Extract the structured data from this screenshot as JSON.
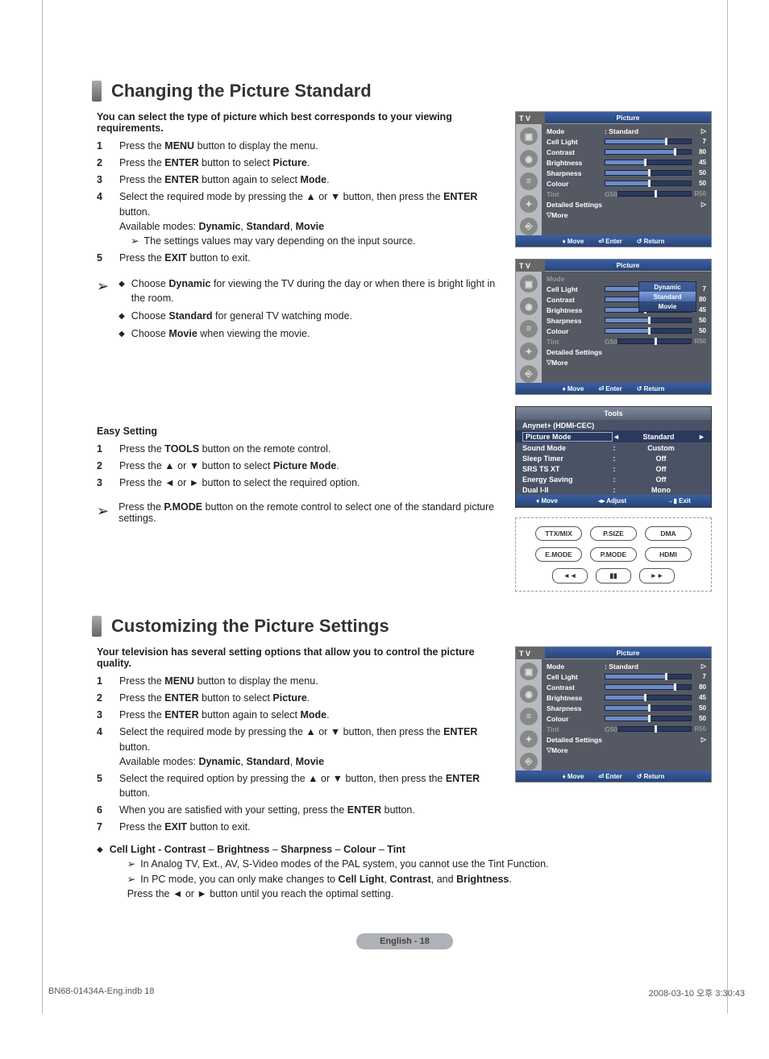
{
  "section1": {
    "title": "Changing the Picture Standard",
    "intro": "You can select the type of picture which best corresponds to your viewing requirements.",
    "step1_pre": "Press the ",
    "step1_b": "MENU",
    "step1_post": " button to display the menu.",
    "step2_pre": "Press the ",
    "step2_b": "ENTER",
    "step2_mid": " button to select ",
    "step2_b2": "Picture",
    "step2_post": ".",
    "step3_pre": "Press the ",
    "step3_b": "ENTER",
    "step3_mid": " button again to select ",
    "step3_b2": "Mode",
    "step3_post": ".",
    "step4_pre": "Select the required mode by pressing the ▲ or ▼ button, then press the ",
    "step4_b": "ENTER",
    "step4_post": " button.",
    "step4_avail_pre": "Available modes: ",
    "step4_avail_b1": "Dynamic",
    "step4_avail_s1": ", ",
    "step4_avail_b2": "Standard",
    "step4_avail_s2": ", ",
    "step4_avail_b3": "Movie",
    "step4_note": "The settings values may vary depending on the input source.",
    "step5_pre": "Press the ",
    "step5_b": "EXIT",
    "step5_post": " button to exit.",
    "tip1_pre": "Choose ",
    "tip1_b": "Dynamic",
    "tip1_post": " for viewing the TV during the day or when there is bright light in the room.",
    "tip2_pre": "Choose ",
    "tip2_b": "Standard",
    "tip2_post": " for general TV watching mode.",
    "tip3_pre": "Choose ",
    "tip3_b": "Movie",
    "tip3_post": " when viewing the movie.",
    "easy_title": "Easy Setting",
    "easy1_pre": "Press the ",
    "easy1_b": "TOOLS",
    "easy1_post": " button on the remote control.",
    "easy2_pre": "Press the ▲ or ▼ button to select ",
    "easy2_b": "Picture Mode",
    "easy2_post": ".",
    "easy3": "Press the ◄ or ► button to select the required option.",
    "pmode_pre": "Press the ",
    "pmode_b": "P.MODE",
    "pmode_post": " button on the remote control to select one of the standard picture settings."
  },
  "section2": {
    "title": "Customizing the Picture Settings",
    "intro": "Your television has several setting options that allow you to control the picture quality.",
    "step1_pre": "Press the ",
    "step1_b": "MENU",
    "step1_post": " button to display the menu.",
    "step2_pre": "Press the ",
    "step2_b": "ENTER",
    "step2_mid": " button to select ",
    "step2_b2": "Picture",
    "step2_post": ".",
    "step3_pre": "Press the ",
    "step3_b": "ENTER",
    "step3_mid": " button again to select ",
    "step3_b2": "Mode",
    "step3_post": ".",
    "step4_pre": "Select the required mode by pressing the ▲ or ▼ button, then press the ",
    "step4_b": "ENTER",
    "step4_post": " button.",
    "step4_avail_pre": "Available modes: ",
    "step4_avail_b1": "Dynamic",
    "step4_avail_s1": ", ",
    "step4_avail_b2": "Standard",
    "step4_avail_s2": ", ",
    "step4_avail_b3": "Movie",
    "step5_pre": "Select the required option by pressing the ▲ or ▼ button, then press the ",
    "step5_b": "ENTER",
    "step5_post": " button.",
    "step6_pre": "When you are satisfied with your setting, press the ",
    "step6_b": "ENTER",
    "step6_post": " button.",
    "step7_pre": "Press the ",
    "step7_b": "EXIT",
    "step7_post": " button to exit.",
    "param_b1": "Cell Light - Contrast",
    "param_s1": " – ",
    "param_b2": "Brightness",
    "param_s2": " – ",
    "param_b3": "Sharpness",
    "param_s3": " – ",
    "param_b4": "Colour",
    "param_s4": " – ",
    "param_b5": "Tint",
    "note1": "In Analog TV, Ext., AV, S-Video modes of the PAL system, you cannot use the Tint Function.",
    "note2_pre": "In PC mode, you can only make changes to ",
    "note2_b1": "Cell Light",
    "note2_s1": ", ",
    "note2_b2": "Contrast",
    "note2_s2": ", and ",
    "note2_b3": "Brightness",
    "note2_post": ".",
    "note3": "Press the ◄ or ► button until you reach the optimal setting."
  },
  "osd": {
    "tv_label": "T V",
    "header": "Picture",
    "mode": "Mode",
    "mode_val": ": Standard",
    "cell_light": "Cell Light",
    "cell_light_val": "7",
    "contrast": "Contrast",
    "contrast_val": "80",
    "brightness": "Brightness",
    "brightness_val": "45",
    "sharpness": "Sharpness",
    "sharpness_val": "50",
    "colour": "Colour",
    "colour_val": "50",
    "tint": "Tint",
    "tint_l": "G50",
    "tint_r": "R50",
    "detailed": "Detailed Settings",
    "more": "More",
    "foot_move": "Move",
    "foot_enter": "Enter",
    "foot_return": "Return",
    "dropdown": {
      "dynamic": "Dynamic",
      "standard": "Standard",
      "movie": "Movie"
    }
  },
  "tools": {
    "header": "Tools",
    "anynet": "Anynet+ (HDMI-CEC)",
    "pm": "Picture Mode",
    "pm_val": "Standard",
    "sm": "Sound Mode",
    "sm_val": "Custom",
    "st": "Sleep Timer",
    "st_val": "Off",
    "srs": "SRS TS XT",
    "srs_val": "Off",
    "es": "Energy Saving",
    "es_val": "Off",
    "dual": "Dual I-II",
    "dual_val": "Mono",
    "foot_move": "Move",
    "foot_adjust": "Adjust",
    "foot_exit": "Exit"
  },
  "remote": {
    "ttx": "TTX/MIX",
    "psize": "P.SIZE",
    "dma": "DMA",
    "emode": "E.MODE",
    "pmode": "P.MODE",
    "hdmi": "HDMI",
    "rew": "◄◄",
    "play": "▮▮",
    "fwd": "►►"
  },
  "footer": {
    "lang": "English - 18",
    "file": "BN68-01434A-Eng.indb   18",
    "date": "2008-03-10   오후 3:30:43"
  }
}
